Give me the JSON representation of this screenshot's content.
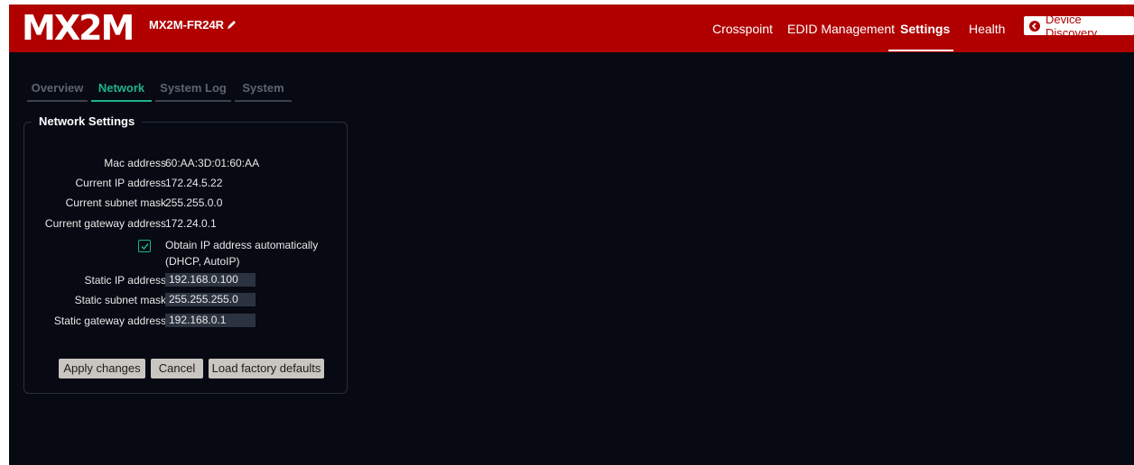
{
  "header": {
    "logo": "MX2M",
    "device_name": "MX2M-FR24R",
    "nav": {
      "crosspoint": "Crosspoint",
      "edid": "EDID Management",
      "settings": "Settings",
      "health": "Health"
    },
    "device_discovery": "Device Discovery"
  },
  "tabs": {
    "overview": "Overview",
    "network": "Network",
    "system_log": "System Log",
    "system": "System"
  },
  "network": {
    "title": "Network Settings",
    "mac_label": "Mac address",
    "mac_value": "60:AA:3D:01:60:AA",
    "ip_label": "Current IP address",
    "ip_value": "172.24.5.22",
    "subnet_label": "Current subnet mask",
    "subnet_value": "255.255.0.0",
    "gateway_label": "Current gateway address",
    "gateway_value": "172.24.0.1",
    "dhcp_label": "Obtain IP address automatically (DHCP, AutoIP)",
    "dhcp_checked": true,
    "static_ip_label": "Static IP address",
    "static_ip_value": "192.168.0.100",
    "static_subnet_label": "Static subnet mask",
    "static_subnet_value": "255.255.255.0",
    "static_gateway_label": "Static gateway address",
    "static_gateway_value": "192.168.0.1"
  },
  "buttons": {
    "apply": "Apply changes",
    "cancel": "Cancel",
    "factory": "Load factory defaults"
  },
  "colors": {
    "brand_red": "#b00000",
    "accent_green": "#1fb486",
    "background": "#070a13"
  },
  "icons": {
    "edit": "pencil-icon",
    "discovery": "chevron-left-circle-icon",
    "checkbox": "checkmark-icon"
  }
}
